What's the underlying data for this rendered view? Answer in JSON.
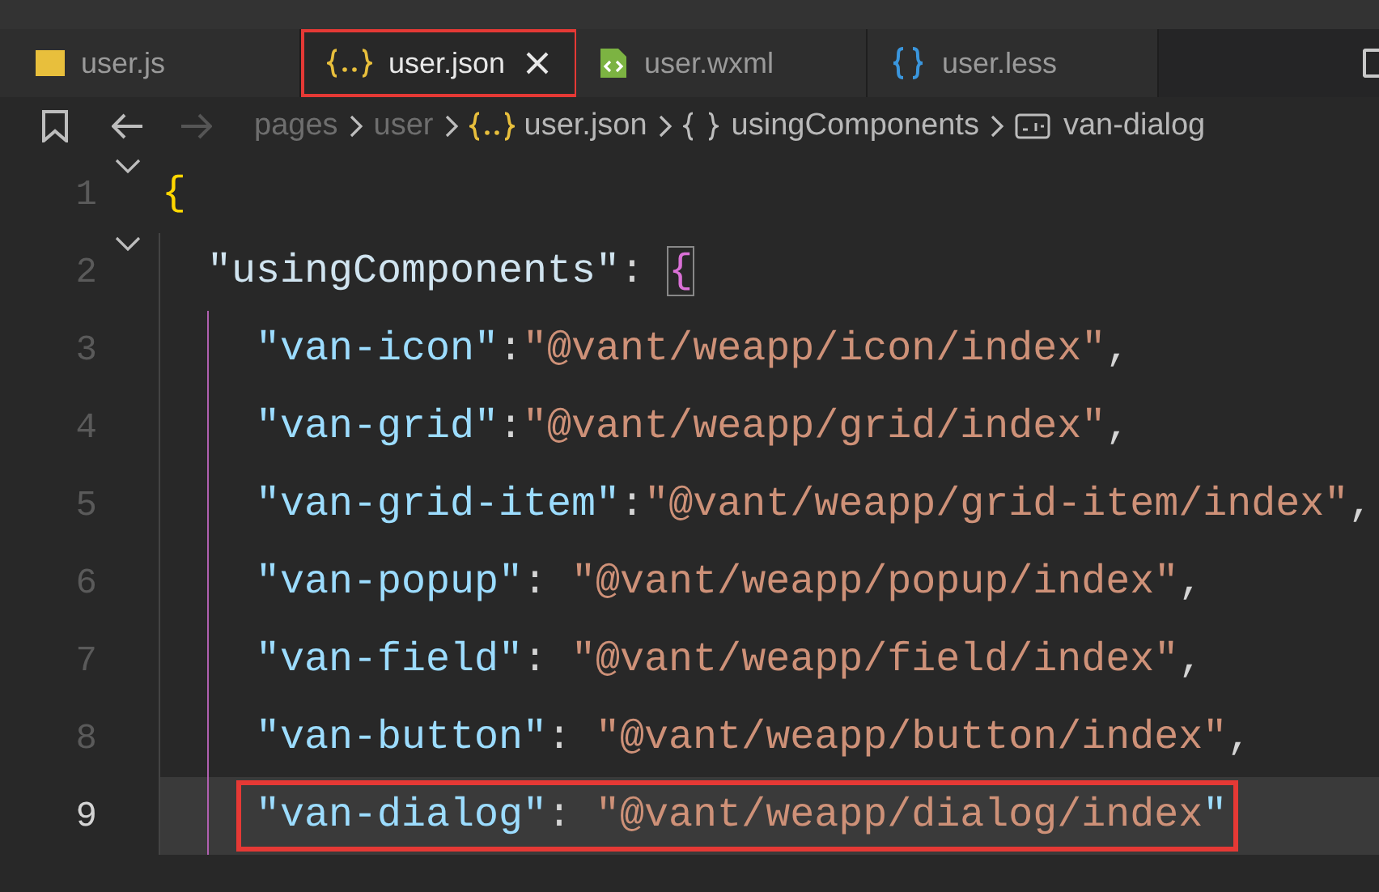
{
  "tabs": [
    {
      "label": "user.js",
      "kind": "js",
      "selected": false,
      "annotated": false,
      "closable": false
    },
    {
      "label": "user.json",
      "kind": "json",
      "selected": true,
      "annotated": true,
      "closable": true
    },
    {
      "label": "user.wxml",
      "kind": "wxml",
      "selected": false,
      "annotated": false,
      "closable": false
    },
    {
      "label": "user.less",
      "kind": "less",
      "selected": false,
      "annotated": false,
      "closable": false
    }
  ],
  "breadcrumb": [
    {
      "label": "pages",
      "kind": "folder"
    },
    {
      "label": "user",
      "kind": "folder"
    },
    {
      "label": "user.json",
      "kind": "file"
    },
    {
      "label": "usingComponents",
      "kind": "object"
    },
    {
      "label": "van-dialog",
      "kind": "string"
    }
  ],
  "lines": [
    {
      "number": "1",
      "foldable": true,
      "current": false,
      "annotated": false,
      "tokens": [
        {
          "kind": "brace",
          "text": "{"
        }
      ],
      "children": [
        {
          "number": "2",
          "foldable": true,
          "current": false,
          "annotated": false,
          "tokens": [
            {
              "kind": "prop",
              "text": "\"usingComponents\""
            },
            {
              "kind": "punct",
              "text": ": "
            },
            {
              "kind": "match",
              "text": "{"
            }
          ],
          "children": [
            {
              "number": "3",
              "foldable": false,
              "current": false,
              "annotated": false,
              "tokens": [
                {
                  "kind": "key",
                  "text": "\"van-icon\""
                },
                {
                  "kind": "punct",
                  "text": ":"
                },
                {
                  "kind": "string",
                  "text": "\"@vant/weapp/icon/index\""
                },
                {
                  "kind": "punct",
                  "text": ","
                }
              ]
            },
            {
              "number": "4",
              "foldable": false,
              "current": false,
              "annotated": false,
              "tokens": [
                {
                  "kind": "key",
                  "text": "\"van-grid\""
                },
                {
                  "kind": "punct",
                  "text": ":"
                },
                {
                  "kind": "string",
                  "text": "\"@vant/weapp/grid/index\""
                },
                {
                  "kind": "punct",
                  "text": ","
                }
              ]
            },
            {
              "number": "5",
              "foldable": false,
              "current": false,
              "annotated": false,
              "tokens": [
                {
                  "kind": "key",
                  "text": "\"van-grid-item\""
                },
                {
                  "kind": "punct",
                  "text": ":"
                },
                {
                  "kind": "string",
                  "text": "\"@vant/weapp/grid-item/index\""
                },
                {
                  "kind": "punct",
                  "text": ","
                }
              ]
            },
            {
              "number": "6",
              "foldable": false,
              "current": false,
              "annotated": false,
              "tokens": [
                {
                  "kind": "key",
                  "text": "\"van-popup\""
                },
                {
                  "kind": "punct",
                  "text": ": "
                },
                {
                  "kind": "string",
                  "text": "\"@vant/weapp/popup/index\""
                },
                {
                  "kind": "punct",
                  "text": ","
                }
              ]
            },
            {
              "number": "7",
              "foldable": false,
              "current": false,
              "annotated": false,
              "tokens": [
                {
                  "kind": "key",
                  "text": "\"van-field\""
                },
                {
                  "kind": "punct",
                  "text": ": "
                },
                {
                  "kind": "string",
                  "text": "\"@vant/weapp/field/index\""
                },
                {
                  "kind": "punct",
                  "text": ","
                }
              ]
            },
            {
              "number": "8",
              "foldable": false,
              "current": false,
              "annotated": false,
              "tokens": [
                {
                  "kind": "key",
                  "text": "\"van-button\""
                },
                {
                  "kind": "punct",
                  "text": ": "
                },
                {
                  "kind": "string",
                  "text": "\"@vant/weapp/button/index\""
                },
                {
                  "kind": "punct",
                  "text": ","
                }
              ]
            },
            {
              "number": "9",
              "foldable": false,
              "current": true,
              "annotated": true,
              "tokens": [
                {
                  "kind": "key",
                  "text": "\"van-dialog\""
                },
                {
                  "kind": "punct",
                  "text": ": "
                },
                {
                  "kind": "string",
                  "text": "\"@vant/weapp/dialog/index"
                },
                {
                  "kind": "key",
                  "text": "\""
                }
              ]
            }
          ]
        }
      ]
    }
  ]
}
